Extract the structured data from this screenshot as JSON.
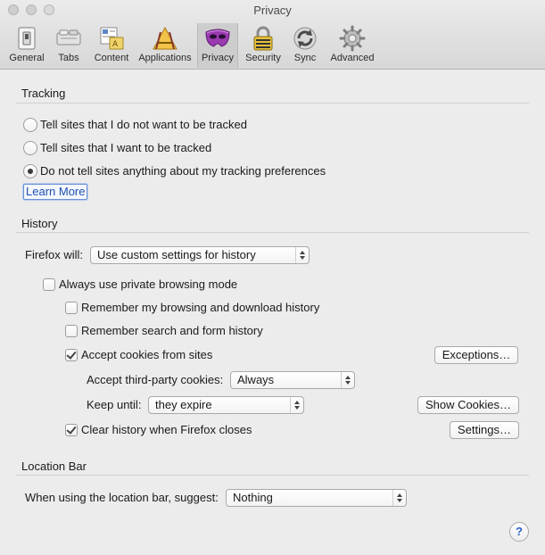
{
  "window": {
    "title": "Privacy"
  },
  "toolbar": {
    "items": [
      {
        "label": "General",
        "icon": "switch-icon"
      },
      {
        "label": "Tabs",
        "icon": "tabs-icon"
      },
      {
        "label": "Content",
        "icon": "content-icon"
      },
      {
        "label": "Applications",
        "icon": "applications-icon"
      },
      {
        "label": "Privacy",
        "icon": "mask-icon"
      },
      {
        "label": "Security",
        "icon": "lock-icon"
      },
      {
        "label": "Sync",
        "icon": "sync-icon"
      },
      {
        "label": "Advanced",
        "icon": "gear-icon"
      }
    ],
    "selected": "Privacy"
  },
  "tracking": {
    "title": "Tracking",
    "options": [
      {
        "label": "Tell sites that I do not want to be tracked",
        "checked": false
      },
      {
        "label": "Tell sites that I want to be tracked",
        "checked": false
      },
      {
        "label": "Do not tell sites anything about my tracking preferences",
        "checked": true
      }
    ],
    "learn_more": "Learn More"
  },
  "history": {
    "title": "History",
    "firefox_will_label": "Firefox will:",
    "firefox_will_value": "Use custom settings for history",
    "private_browsing": "Always use private browsing mode",
    "remember_browsing": "Remember my browsing and download history",
    "remember_search": "Remember search and form history",
    "accept_cookies": "Accept cookies from sites",
    "exceptions_button": "Exceptions…",
    "third_party_label": "Accept third-party cookies:",
    "third_party_value": "Always",
    "keep_until_label": "Keep until:",
    "keep_until_value": "they expire",
    "show_cookies_button": "Show Cookies…",
    "clear_history": "Clear history when Firefox closes",
    "settings_button": "Settings…"
  },
  "location_bar": {
    "title": "Location Bar",
    "suggest_label": "When using the location bar, suggest:",
    "suggest_value": "Nothing"
  },
  "help": {
    "label": "?"
  },
  "colors": {
    "link": "#1f4fb3",
    "help_icon": "#2a64c8",
    "mask_purple": "#9a3bb0"
  }
}
